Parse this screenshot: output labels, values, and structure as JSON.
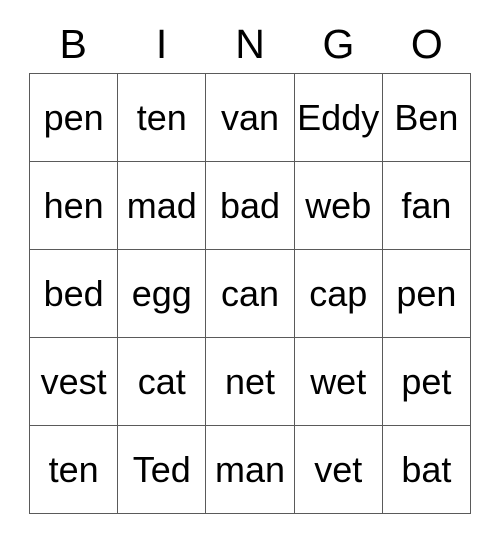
{
  "card": {
    "header_letters": [
      "B",
      "I",
      "N",
      "G",
      "O"
    ],
    "grid": {
      "rows": [
        [
          "pen",
          "ten",
          "van",
          "Eddy",
          "Ben"
        ],
        [
          "hen",
          "mad",
          "bad",
          "web",
          "fan"
        ],
        [
          "bed",
          "egg",
          "can",
          "cap",
          "pen"
        ],
        [
          "vest",
          "cat",
          "net",
          "wet",
          "pet"
        ],
        [
          "ten",
          "Ted",
          "man",
          "vet",
          "bat"
        ]
      ]
    },
    "colors": {
      "background": "#ffffff",
      "text": "#000000",
      "border": "#5a5a5a"
    }
  }
}
